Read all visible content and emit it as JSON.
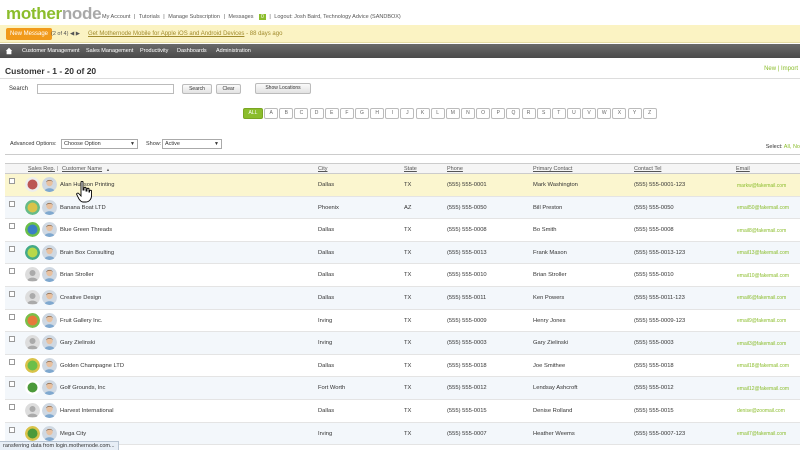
{
  "brand": {
    "logo_mother": "mother",
    "logo_node": "node",
    "green": "#8bbd2c",
    "orange": "#f19a1a"
  },
  "toplinks": {
    "my_account": "My Account",
    "tutorials": "Tutorials",
    "manage_subscription": "Manage Subscription",
    "messages": "Messages",
    "messages_count": "0",
    "logout": "Logout: Josh Baird, Technology Advice (SANDBOX)",
    "sep": "|"
  },
  "notice": {
    "new_message": "New Message",
    "pager": "(2 of 4)",
    "prev_arrow": "◀",
    "next_arrow": "▶",
    "link": "Get Mothernode Mobile for Apple iOS and Android Devices",
    "suffix": " - 88 days ago"
  },
  "nav": {
    "items": [
      "Customer Management",
      "Sales Management",
      "Productivity",
      "Dashboards",
      "Administration"
    ]
  },
  "page": {
    "title": "Customer - 1 - 20 of 20",
    "actions": [
      "New",
      "Import"
    ]
  },
  "search": {
    "label": "Search",
    "value": "",
    "search_button": "Search",
    "clear_button": "Clear",
    "show_locations_button": "Show Locations"
  },
  "alphabet": [
    "ALL",
    "A",
    "B",
    "C",
    "D",
    "E",
    "F",
    "G",
    "H",
    "I",
    "J",
    "K",
    "L",
    "M",
    "N",
    "O",
    "P",
    "Q",
    "R",
    "S",
    "T",
    "U",
    "V",
    "W",
    "X",
    "Y",
    "Z"
  ],
  "options": {
    "advanced_label": "Advanced Options:",
    "advanced_value": "Choose Option",
    "show_label": "Show:",
    "show_value": "Active",
    "select_label": "Select:",
    "select_links": "All, No"
  },
  "table": {
    "headers": {
      "sales_rep": "Sales Rep.",
      "customer_name": "Customer Name",
      "sort_arrow": "▲",
      "city": "City",
      "state": "State",
      "phone": "Phone",
      "primary_contact": "Primary Contact",
      "contact_tel": "Contact Tel",
      "email": "Email"
    },
    "rows": [
      {
        "name": "Alan Hudson Printing",
        "city": "Dallas",
        "state": "TX",
        "phone": "(555) 555-0001",
        "contact": "Mark Washington",
        "tel": "(555) 555-0001-123",
        "email": "markw@fakemail.com",
        "avatar": "logo"
      },
      {
        "name": "Banana Boat LTD",
        "city": "Phoenix",
        "state": "AZ",
        "phone": "(555) 555-0050",
        "contact": "Bill Preston",
        "tel": "(555) 555-0050",
        "email": "email50@fakemail.com",
        "avatar": "logo"
      },
      {
        "name": "Blue Green Threads",
        "city": "Dallas",
        "state": "TX",
        "phone": "(555) 555-0008",
        "contact": "Bo Smith",
        "tel": "(555) 555-0008",
        "email": "email8@fakemail.com",
        "avatar": "logo"
      },
      {
        "name": "Brain Box Consulting",
        "city": "Dallas",
        "state": "TX",
        "phone": "(555) 555-0013",
        "contact": "Frank Mason",
        "tel": "(555) 555-0013-123",
        "email": "email13@fakemail.com",
        "avatar": "logo"
      },
      {
        "name": "Brian Stroller",
        "city": "Dallas",
        "state": "TX",
        "phone": "(555) 555-0010",
        "contact": "Brian Stroller",
        "tel": "(555) 555-0010",
        "email": "email10@fakemail.com",
        "avatar": "person"
      },
      {
        "name": "Creative Design",
        "city": "Dallas",
        "state": "TX",
        "phone": "(555) 555-0011",
        "contact": "Ken Powers",
        "tel": "(555) 555-0011-123",
        "email": "email6@fakemail.com",
        "avatar": "person"
      },
      {
        "name": "Fruit Gallery Inc.",
        "city": "Irving",
        "state": "TX",
        "phone": "(555) 555-0009",
        "contact": "Henry Jones",
        "tel": "(555) 555-0009-123",
        "email": "email9@fakemail.com",
        "avatar": "logo"
      },
      {
        "name": "Gary Zielinski",
        "city": "Irving",
        "state": "TX",
        "phone": "(555) 555-0003",
        "contact": "Gary Zielinski",
        "tel": "(555) 555-0003",
        "email": "email3@fakemail.com",
        "avatar": "person"
      },
      {
        "name": "Golden Champagne LTD",
        "city": "Dallas",
        "state": "TX",
        "phone": "(555) 555-0018",
        "contact": "Joe Smithee",
        "tel": "(555) 555-0018",
        "email": "email18@fakemail.com",
        "avatar": "logo"
      },
      {
        "name": "Golf Grounds, Inc",
        "city": "Fort Worth",
        "state": "TX",
        "phone": "(555) 555-0012",
        "contact": "Lendsay Ashcroft",
        "tel": "(555) 555-0012",
        "email": "email12@fakemail.com",
        "avatar": "logo"
      },
      {
        "name": "Harvest International",
        "city": "Dallas",
        "state": "TX",
        "phone": "(555) 555-0015",
        "contact": "Denise Rolland",
        "tel": "(555) 555-0015",
        "email": "denise@zoomail.com",
        "avatar": "person"
      },
      {
        "name": "Mega City",
        "city": "Irving",
        "state": "TX",
        "phone": "(555) 555-0007",
        "contact": "Heather Weems",
        "tel": "(555) 555-0007-123",
        "email": "email7@fakemail.com",
        "avatar": "logo"
      }
    ]
  },
  "status": {
    "text": "ransferring data from login.mothernode.com..."
  }
}
